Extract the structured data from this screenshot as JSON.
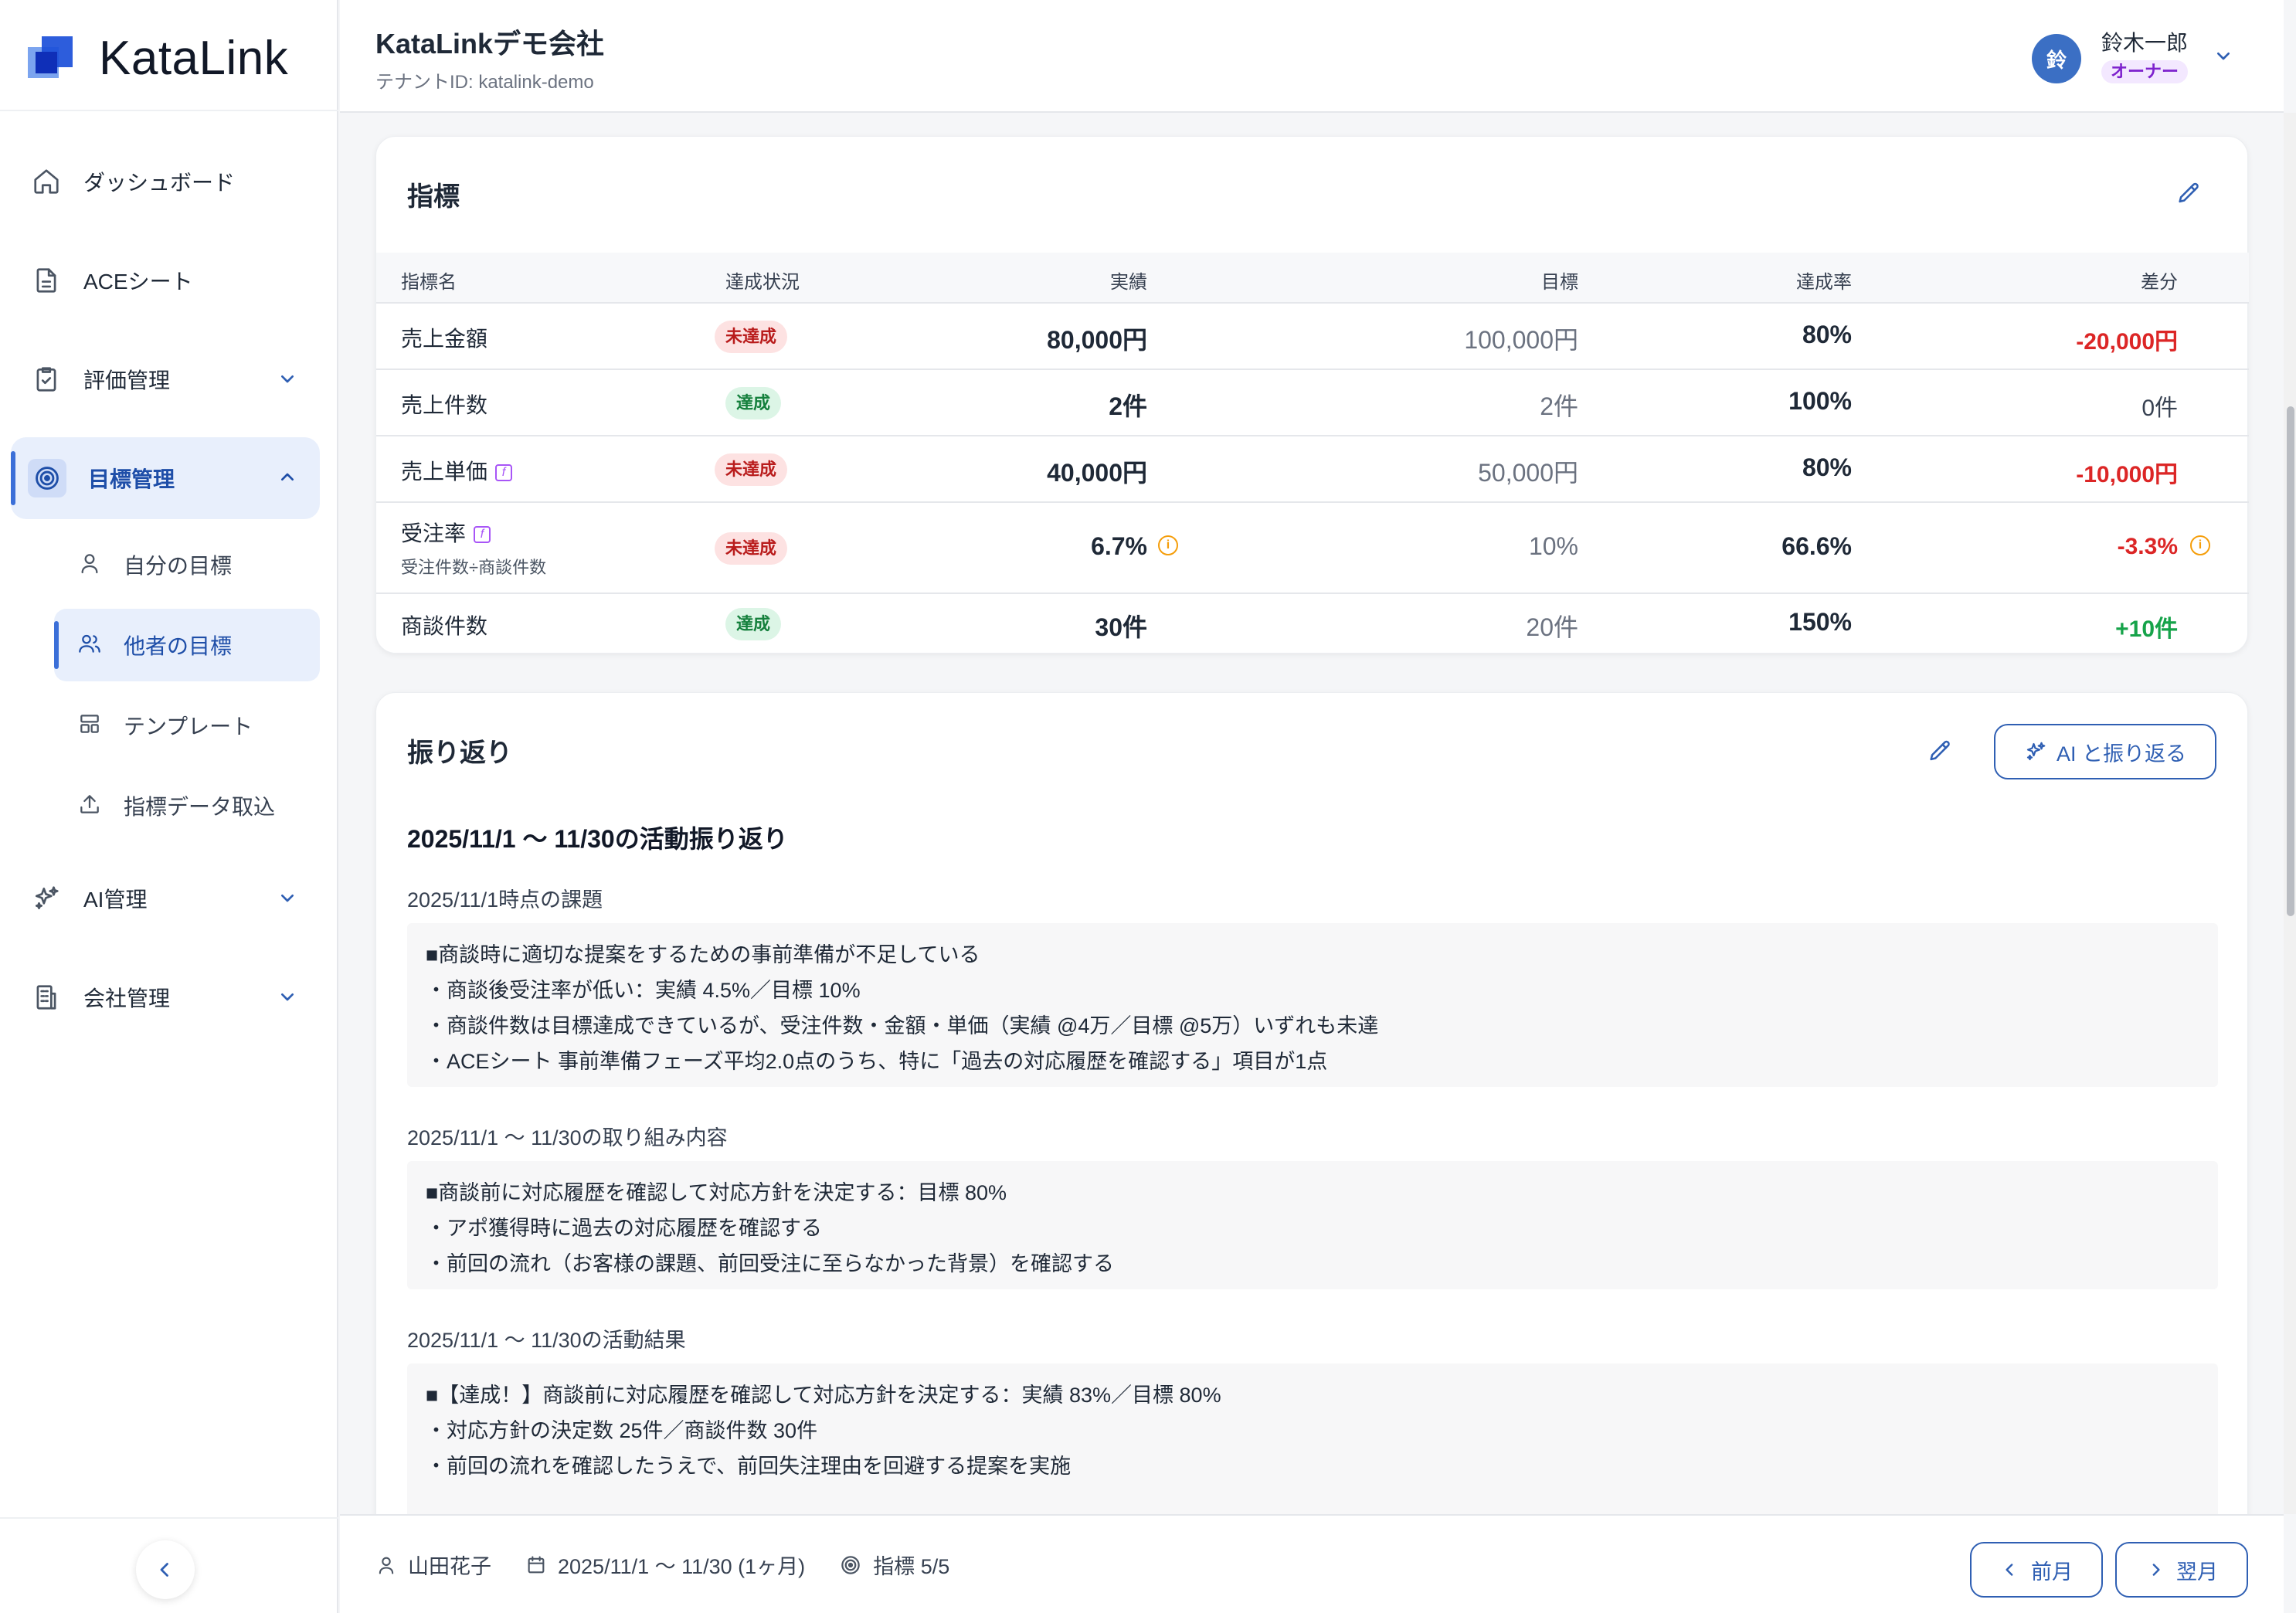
{
  "app": {
    "name": "KataLink"
  },
  "header": {
    "tenant_name": "KataLinkデモ会社",
    "tenant_id": "テナントID: katalink-demo",
    "user": {
      "avatar_initial": "鈴",
      "name": "鈴木一郎",
      "role": "オーナー"
    }
  },
  "sidebar": {
    "items": [
      {
        "label": "ダッシュボード",
        "icon": "home-icon"
      },
      {
        "label": "ACEシート",
        "icon": "document-icon"
      },
      {
        "label": "評価管理",
        "icon": "clipboard-check-icon",
        "expanded": false
      },
      {
        "label": "目標管理",
        "icon": "target-icon",
        "expanded": true,
        "active": true
      },
      {
        "label": "AI管理",
        "icon": "sparkles-icon",
        "expanded": false
      },
      {
        "label": "会社管理",
        "icon": "building-icon",
        "expanded": false
      }
    ],
    "goal_sub_items": [
      {
        "label": "自分の目標",
        "icon": "user-icon"
      },
      {
        "label": "他者の目標",
        "icon": "users-icon",
        "active": true
      },
      {
        "label": "テンプレート",
        "icon": "template-icon"
      },
      {
        "label": "指標データ取込",
        "icon": "upload-icon"
      }
    ]
  },
  "metrics": {
    "title": "指標",
    "columns": [
      "指標名",
      "達成状況",
      "実績",
      "目標",
      "達成率",
      "差分"
    ],
    "rows": [
      {
        "name": "売上金額",
        "formula": "",
        "status": "未達成",
        "actual": "80,000円",
        "target": "100,000円",
        "rate": "80%",
        "diff": "-20,000円"
      },
      {
        "name": "売上件数",
        "formula": "",
        "status": "達成",
        "actual": "2件",
        "target": "2件",
        "rate": "100%",
        "diff": "0件"
      },
      {
        "name": "売上単価",
        "formula": "",
        "status": "未達成",
        "actual": "40,000円",
        "target": "50,000円",
        "rate": "80%",
        "diff": "-10,000円"
      },
      {
        "name": "受注率",
        "formula": "受注件数÷商談件数",
        "status": "未達成",
        "actual": "6.7%",
        "target": "10%",
        "rate": "66.6%",
        "diff": "-3.3%"
      },
      {
        "name": "商談件数",
        "formula": "",
        "status": "達成",
        "actual": "30件",
        "target": "20件",
        "rate": "150%",
        "diff": "+10件"
      }
    ]
  },
  "reflection": {
    "title": "振り返り",
    "ai_button": "AI と振り返る",
    "heading": "2025/11/1 〜 11/30の活動振り返り",
    "sections": [
      {
        "label": "2025/11/1時点の課題",
        "lines": [
          "■商談時に適切な提案をするための事前準備が不足している",
          "・商談後受注率が低い：実績 4.5%／目標 10%",
          "・商談件数は目標達成できているが、受注件数・金額・単価（実績 @4万／目標 @5万）いずれも未達",
          "・ACEシート 事前準備フェーズ平均2.0点のうち、特に「過去の対応履歴を確認する」項目が1点"
        ]
      },
      {
        "label": "2025/11/1 〜 11/30の取り組み内容",
        "lines": [
          "■商談前に対応履歴を確認して対応方針を決定する：目標 80%",
          "・アポ獲得時に過去の対応履歴を確認する",
          "・前回の流れ（お客様の課題、前回受注に至らなかった背景）を確認する"
        ]
      },
      {
        "label": "2025/11/1 〜 11/30の活動結果",
        "lines": [
          "■【達成！】商談前に対応履歴を確認して対応方針を決定する：実績 83%／目標 80%",
          "・対応方針の決定数 25件／商談件数 30件",
          "・前回の流れを確認したうえで、前回失注理由を回避する提案を実施"
        ]
      }
    ]
  },
  "footer": {
    "person": "山田花子",
    "period": "2025/11/1 〜 11/30 (1ヶ月)",
    "metrics_count": "指標 5/5",
    "prev_button": "前月",
    "next_button": "翌月"
  },
  "colors": {
    "accent": "#2f5fb3",
    "active_bg": "#e8effc",
    "negative": "#dc2626",
    "positive": "#16a34a",
    "formula": "#a855f7"
  }
}
